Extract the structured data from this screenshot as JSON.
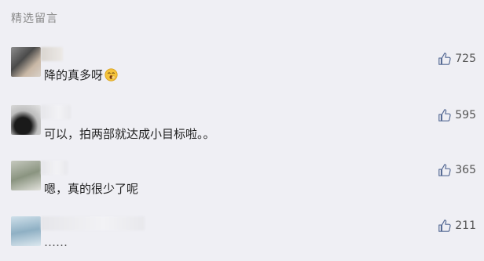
{
  "section": {
    "title": "精选留言"
  },
  "comments": [
    {
      "text": "降的真多呀",
      "emoji": "yawning-face-emoji",
      "likes": "725"
    },
    {
      "text": "可以，拍两部就达成小目标啦。。",
      "likes": "595"
    },
    {
      "text": "嗯，真的很少了呢",
      "likes": "365"
    },
    {
      "text": "……",
      "likes": "211"
    }
  ],
  "icons": {
    "like": "thumbs-up-icon"
  },
  "colors": {
    "background": "#efeff4",
    "text": "#222222",
    "muted": "#8a8a8a",
    "like": "#555555"
  }
}
